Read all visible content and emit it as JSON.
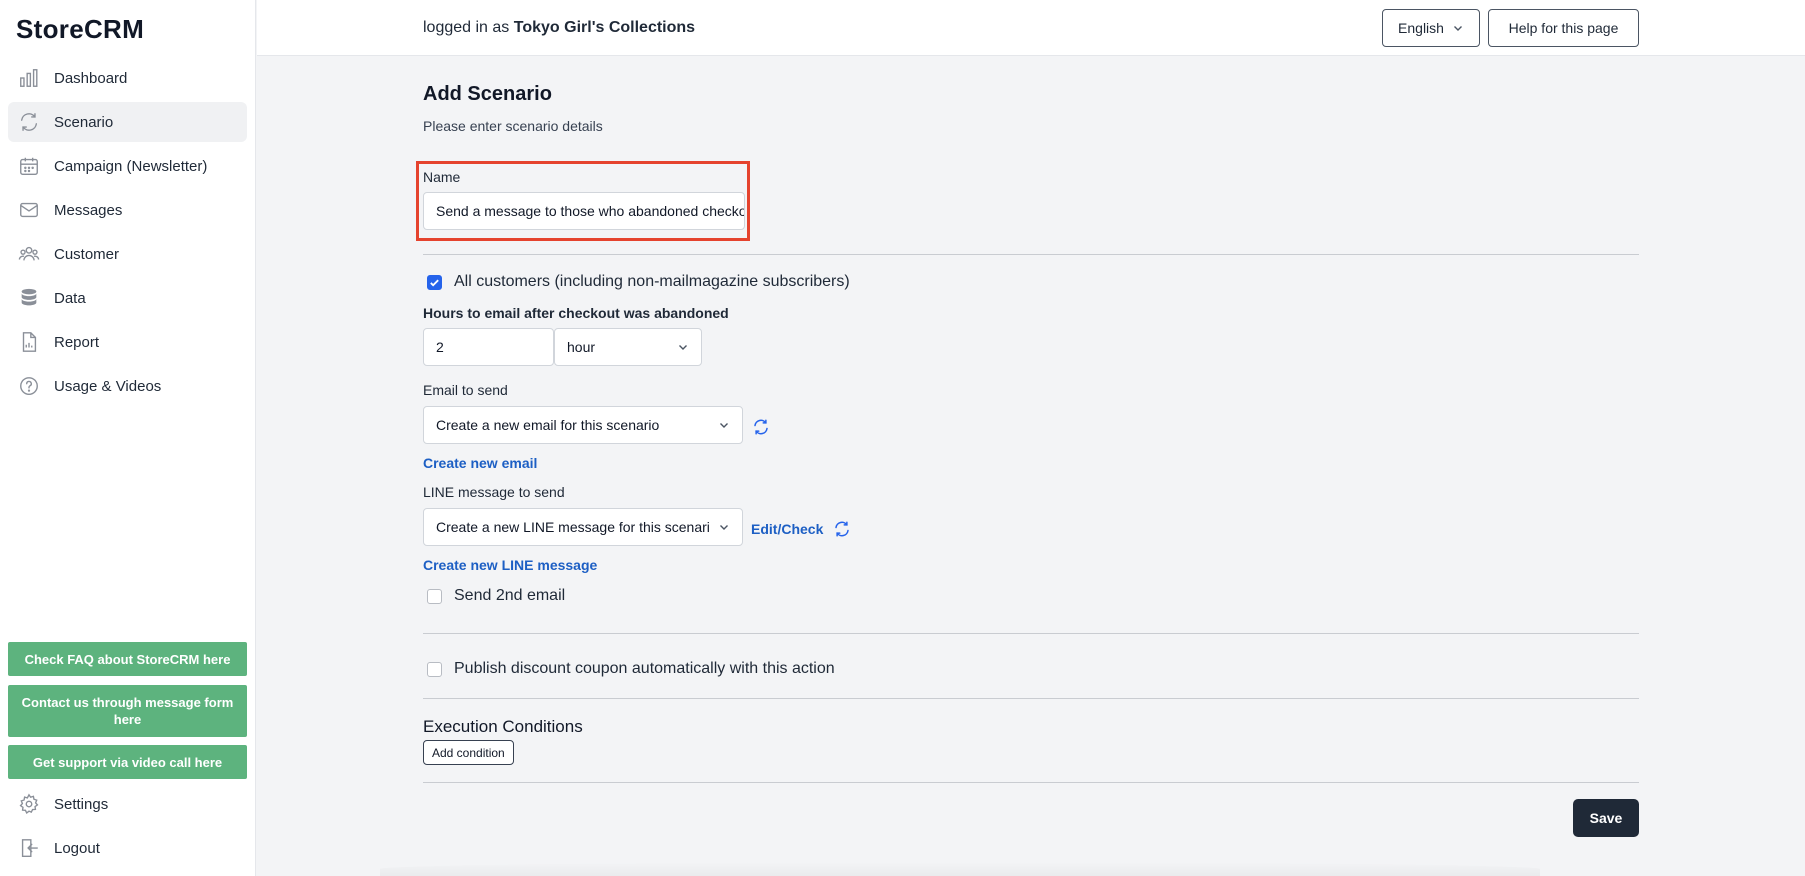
{
  "app": {
    "logo": "StoreCRM"
  },
  "sidebar": {
    "items": [
      {
        "label": "Dashboard",
        "icon": "bar-chart-icon"
      },
      {
        "label": "Scenario",
        "icon": "refresh-cycle-icon",
        "active": true
      },
      {
        "label": "Campaign (Newsletter)",
        "icon": "calendar-icon"
      },
      {
        "label": "Messages",
        "icon": "envelope-icon"
      },
      {
        "label": "Customer",
        "icon": "users-icon"
      },
      {
        "label": "Data",
        "icon": "database-icon"
      },
      {
        "label": "Report",
        "icon": "document-chart-icon"
      },
      {
        "label": "Usage & Videos",
        "icon": "question-circle-icon"
      }
    ],
    "help_buttons": {
      "faq": "Check FAQ about StoreCRM here",
      "contact": "Contact us through message form here",
      "video": "Get support via video call here"
    },
    "settings": "Settings",
    "logout": "Logout"
  },
  "topbar": {
    "logged_in_prefix": "logged in as",
    "store_name": "Tokyo Girl's Collections",
    "language": "English",
    "help": "Help for this page"
  },
  "form": {
    "title": "Add Scenario",
    "subtitle": "Please enter scenario details",
    "name_label": "Name",
    "name_value": "Send a message to those who abandoned checkout",
    "all_customers_label": "All customers (including non-mailmagazine subscribers)",
    "all_customers_checked": true,
    "hours_label": "Hours to email after checkout was abandoned",
    "hours_value": "2",
    "hours_unit": "hour",
    "email_label": "Email to send",
    "email_value": "Create a new email for this scenario",
    "create_email_link": "Create new email",
    "line_label": "LINE message to send",
    "line_value": "Create a new LINE message for this scenario",
    "edit_check_link": "Edit/Check",
    "create_line_link": "Create new LINE message",
    "second_email_label": "Send 2nd email",
    "second_email_checked": false,
    "coupon_label": "Publish discount coupon automatically with this action",
    "coupon_checked": false,
    "conditions_title": "Execution Conditions",
    "add_condition": "Add condition",
    "save": "Save"
  },
  "colors": {
    "accent": "#2563eb",
    "help_green": "#5db37e",
    "highlight_red": "#e5432e",
    "save_dark": "#1f2937"
  }
}
